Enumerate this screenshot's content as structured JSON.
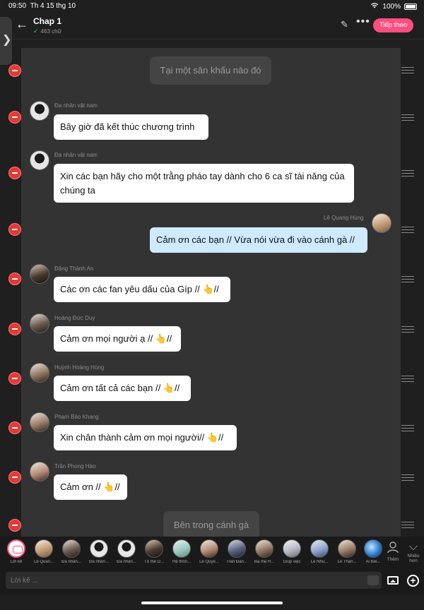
{
  "status": {
    "time": "09:50",
    "date": "Th 4 15 thg 10",
    "battery": "100%"
  },
  "header": {
    "title": "Chap 1",
    "word_count": "463 chữ",
    "continue_label": "Tiếp theo"
  },
  "icons": {
    "back": "←",
    "pencil": "✎",
    "more": "•••",
    "rail": "❯",
    "check": "✓",
    "wifi": "wifi-icon",
    "collapse": "⌵",
    "add_char": "+"
  },
  "messages": [
    {
      "type": "narration",
      "text": "Tại một sân khấu nào đó"
    },
    {
      "type": "other",
      "name": "Đa nhân vật nam",
      "text": "Bây giờ đã kết thúc chương trình"
    },
    {
      "type": "other",
      "name": "Đa nhân vật nam",
      "text": "Xin các bạn hãy cho một trằng pháo tay dành cho 6 ca sĩ tài năng của chúng ta"
    },
    {
      "type": "me",
      "name": "Lê Quang Hùng",
      "text": "Cảm ơn các bạn // Vừa nói vừa đi vào cánh gà //"
    },
    {
      "type": "other",
      "name": "Đặng Thành An",
      "text": "Các ơn các fan yêu dấu của Gíp // 👆//"
    },
    {
      "type": "other",
      "name": "Hoàng Đức Duy",
      "text": "Cảm ơn mọi người ạ // 👆//"
    },
    {
      "type": "other",
      "name": "Huỳnh Hoàng Hùng",
      "text": "Cảm ơn tất cả các bạn // 👆//"
    },
    {
      "type": "other",
      "name": "Phạm Bảo Khang",
      "text": "Xin chân thành cảm ơn mọi người// 👆//"
    },
    {
      "type": "other",
      "name": "Trần Phong Hào",
      "text": "Cảm ơn // 👆//"
    },
    {
      "type": "narration",
      "text": "Bên trong cánh gà"
    }
  ],
  "characters": [
    "Lời kể",
    "Lê Quan...",
    "Đa nhân...",
    "Đa nhân...",
    "Đa nhân...",
    "Tộ mê D...",
    "Hệ thốn...",
    "Lê Quyê...",
    "Trần Đăn...",
    "Ba mẹ H...",
    "Giúp việc",
    "Lê Nhu...",
    "Lê Than...",
    "Ái Bei..."
  ],
  "more_labels": {
    "add": "Thêm",
    "expand": "Nhiều hơn"
  },
  "composer": {
    "placeholder": "Lời kể ..."
  }
}
